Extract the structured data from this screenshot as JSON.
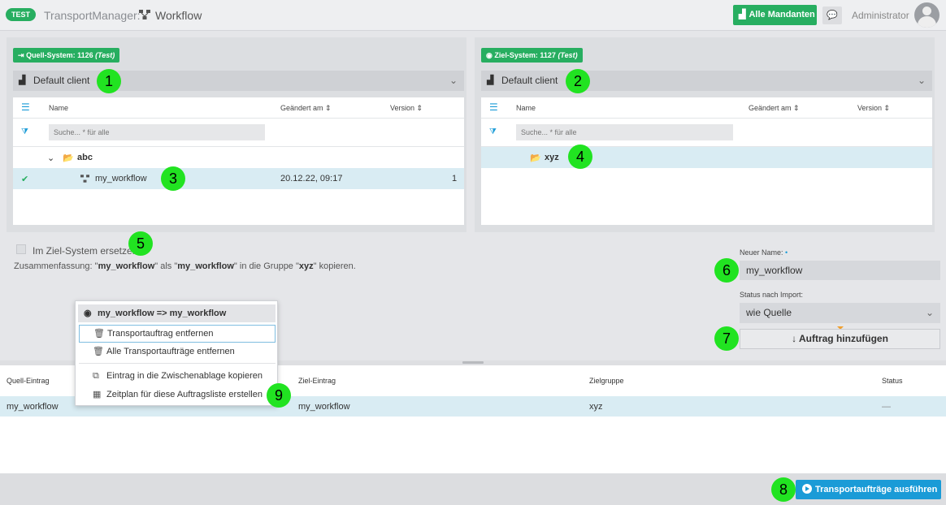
{
  "header": {
    "env_badge": "TEST",
    "app_title": "TransportManager:",
    "page_name": "Workflow",
    "all_clients_label": "Alle Mandanten",
    "user_name": "Administrator"
  },
  "source": {
    "system_label": "Quell-System: 1126",
    "system_suffix": "(Test)",
    "client": "Default client",
    "columns": {
      "name": "Name",
      "changed": "Geändert am",
      "version": "Version"
    },
    "search_placeholder": "Suche... * für alle",
    "group": "abc",
    "item": {
      "name": "my_workflow",
      "changed": "20.12.22, 09:17",
      "version": "1"
    }
  },
  "target": {
    "system_label": "Ziel-System: 1127",
    "system_suffix": "(Test)",
    "client": "Default client",
    "columns": {
      "name": "Name",
      "changed": "Geändert am",
      "version": "Version"
    },
    "search_placeholder": "Suche... * für alle",
    "group": "xyz"
  },
  "options": {
    "replace_label": "Im Ziel-System ersetzen",
    "summary_prefix": "Zusammenfassung: \"",
    "summary_src": "my_workflow",
    "summary_mid1": "\" als \"",
    "summary_dst": "my_workflow",
    "summary_mid2": "\" in die Gruppe \"",
    "summary_group": "xyz",
    "summary_suffix": "\" kopieren.",
    "new_name_label": "Neuer Name:",
    "new_name_value": "my_workflow",
    "status_label": "Status nach Import:",
    "status_value": "wie Quelle",
    "add_button": "Auftrag hinzufügen"
  },
  "context_menu": {
    "title": "my_workflow => my_workflow",
    "items": [
      "Transportauftrag entfernen",
      "Alle Transportaufträge entfernen",
      "Eintrag in die Zwischenablage kopieren",
      "Zeitplan für diese Auftragsliste erstellen"
    ]
  },
  "jobs": {
    "columns": {
      "source": "Quell-Eintrag",
      "target": "Ziel-Eintrag",
      "group": "Zielgruppe",
      "status": "Status"
    },
    "rows": [
      {
        "source": "my_workflow",
        "target": "my_workflow",
        "group": "xyz",
        "status": "—"
      }
    ]
  },
  "footer": {
    "run_button": "Transportaufträge ausführen"
  },
  "markers": [
    "1",
    "2",
    "3",
    "4",
    "5",
    "6",
    "7",
    "8",
    "9"
  ],
  "colors": {
    "accent_green": "#27ae60",
    "accent_blue": "#1a9bd7",
    "marker_green": "#21e321",
    "selection": "#d9ecf3"
  }
}
